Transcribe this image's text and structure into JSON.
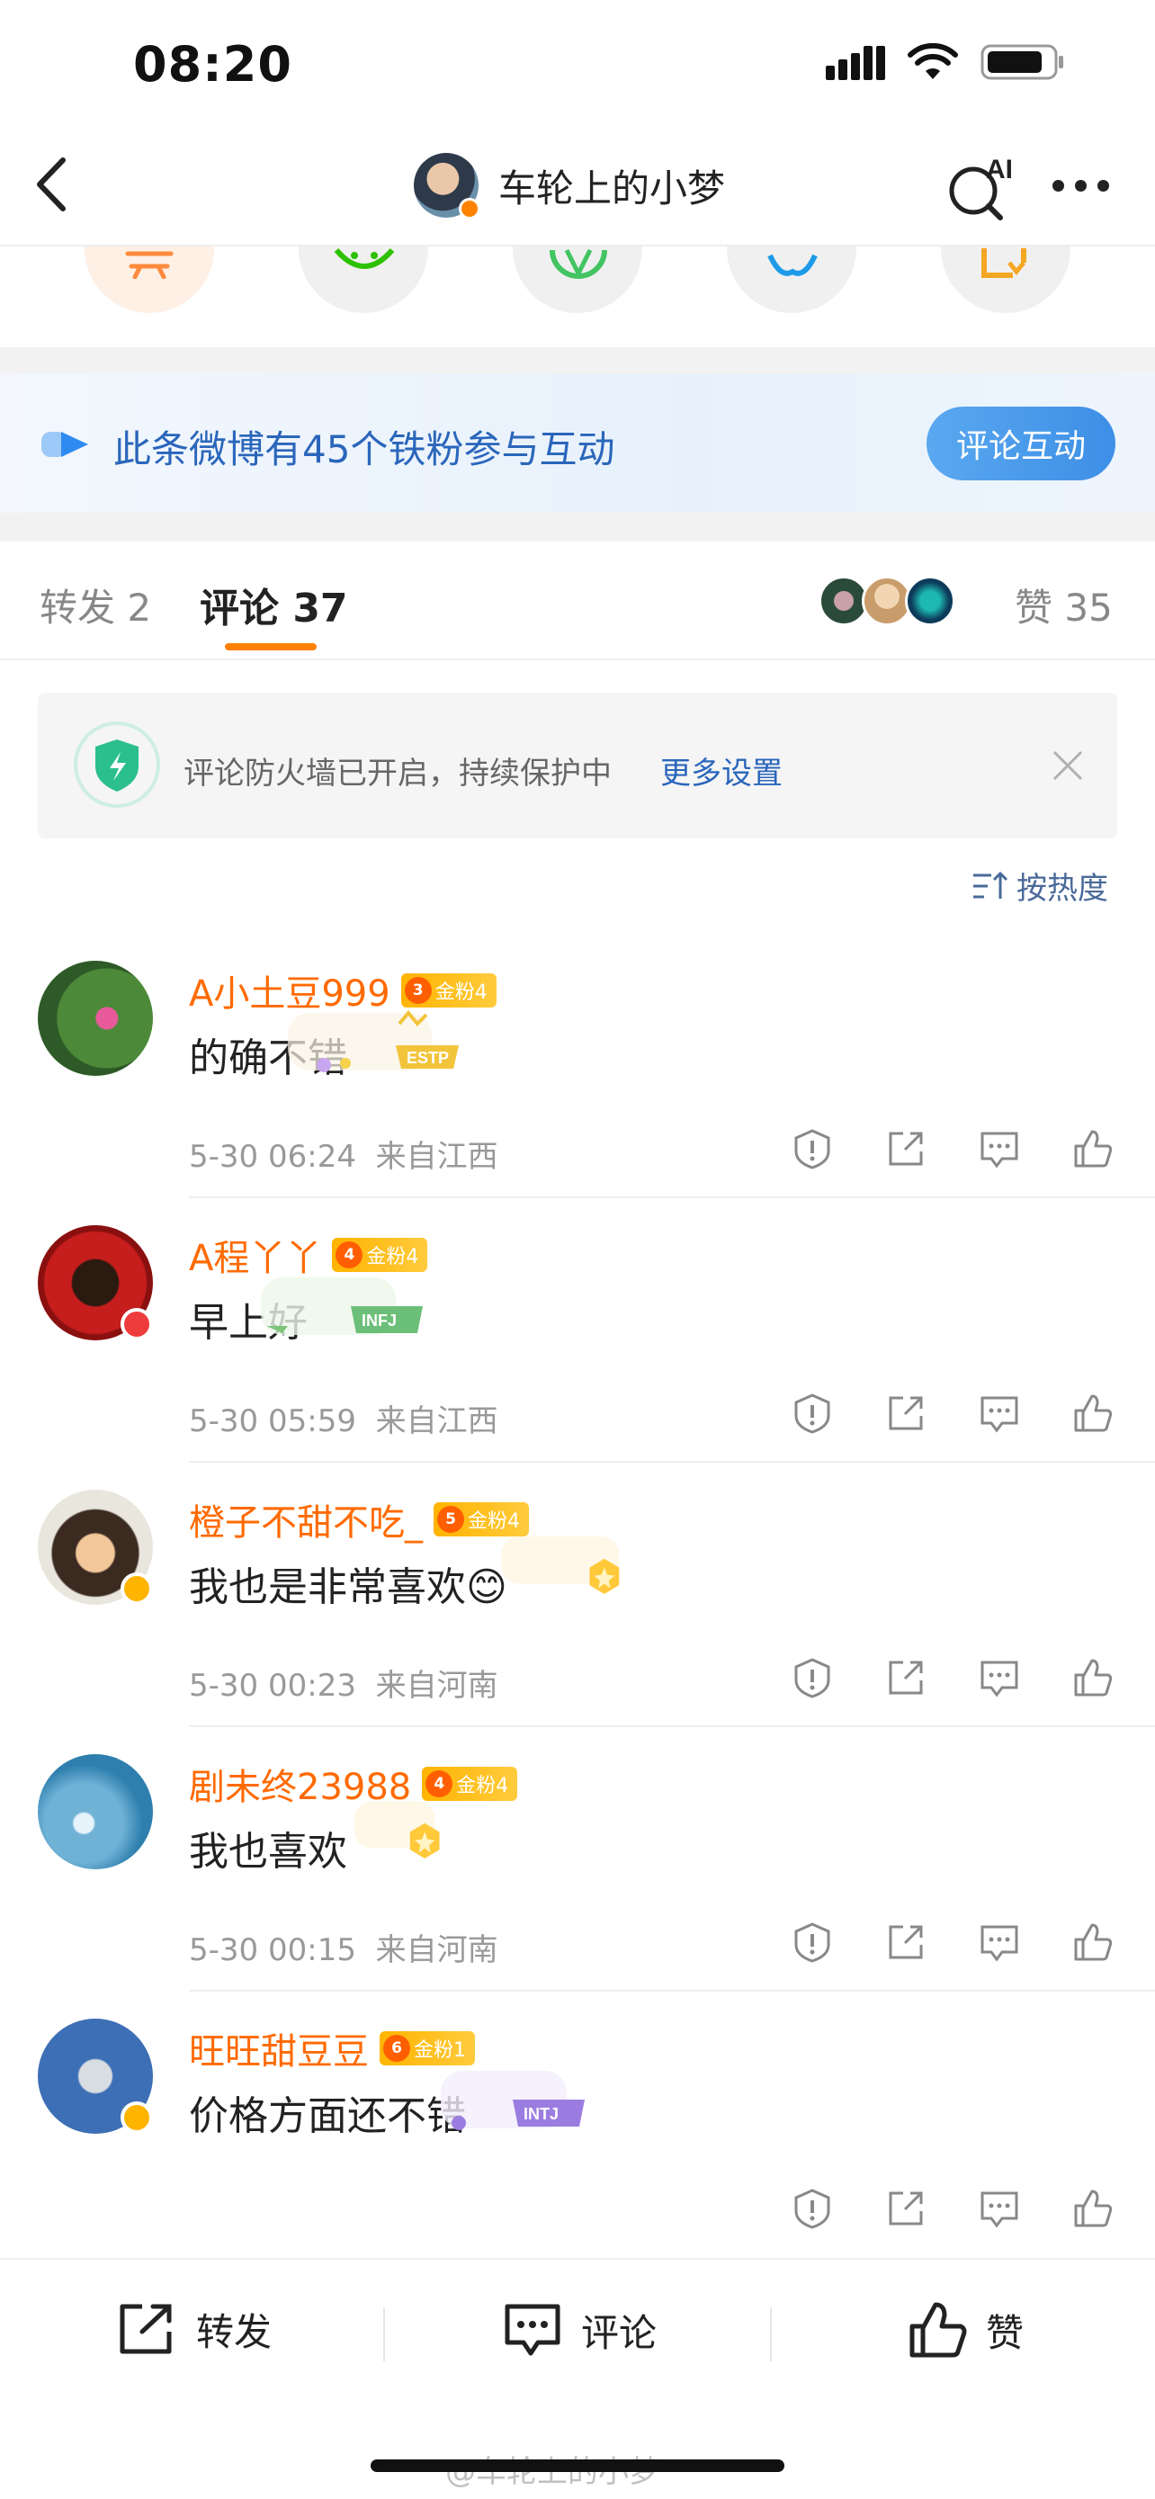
{
  "status": {
    "time": "08:20"
  },
  "nav": {
    "title": "车轮上的小梦",
    "ai_label": "AI"
  },
  "fan_banner": {
    "text": "此条微博有45个铁粉参与互动",
    "button": "评论互动"
  },
  "tabs": {
    "repost": "转发 2",
    "comment": "评论 37",
    "like": "赞 35"
  },
  "firewall": {
    "text": "评论防火墙已开启，持续保护中",
    "link": "更多设置"
  },
  "sort": {
    "label": "按热度"
  },
  "comments": [
    {
      "name": "A小土豆999",
      "level": "3",
      "fan": "金粉4",
      "text": "的确不错",
      "deco": "ESTP",
      "time": "5-30 06:24",
      "loc": "来自江西"
    },
    {
      "name": "A程丫丫",
      "level": "4",
      "fan": "金粉4",
      "text": "早上好",
      "deco": "INFJ",
      "time": "5-30 05:59",
      "loc": "来自江西"
    },
    {
      "name": "橙子不甜不吃_",
      "level": "5",
      "fan": "金粉4",
      "text": "我也是非常喜欢",
      "emoji": "😊",
      "time": "5-30 00:23",
      "loc": "来自河南"
    },
    {
      "name": "剧未终23988",
      "level": "4",
      "fan": "金粉4",
      "text": "我也喜欢",
      "time": "5-30 00:15",
      "loc": "来自河南"
    },
    {
      "name": "旺旺甜豆豆",
      "level": "6",
      "fan": "金粉1",
      "text": "价格方面还不错",
      "deco": "INTJ",
      "time": "",
      "loc": ""
    }
  ],
  "bottom": {
    "repost": "转发",
    "comment": "评论",
    "like": "赞"
  },
  "watermark": "@车轮上的小梦",
  "colors": {
    "accent": "#ff8200",
    "link": "#2a66bb",
    "name": "#ff6a00"
  }
}
